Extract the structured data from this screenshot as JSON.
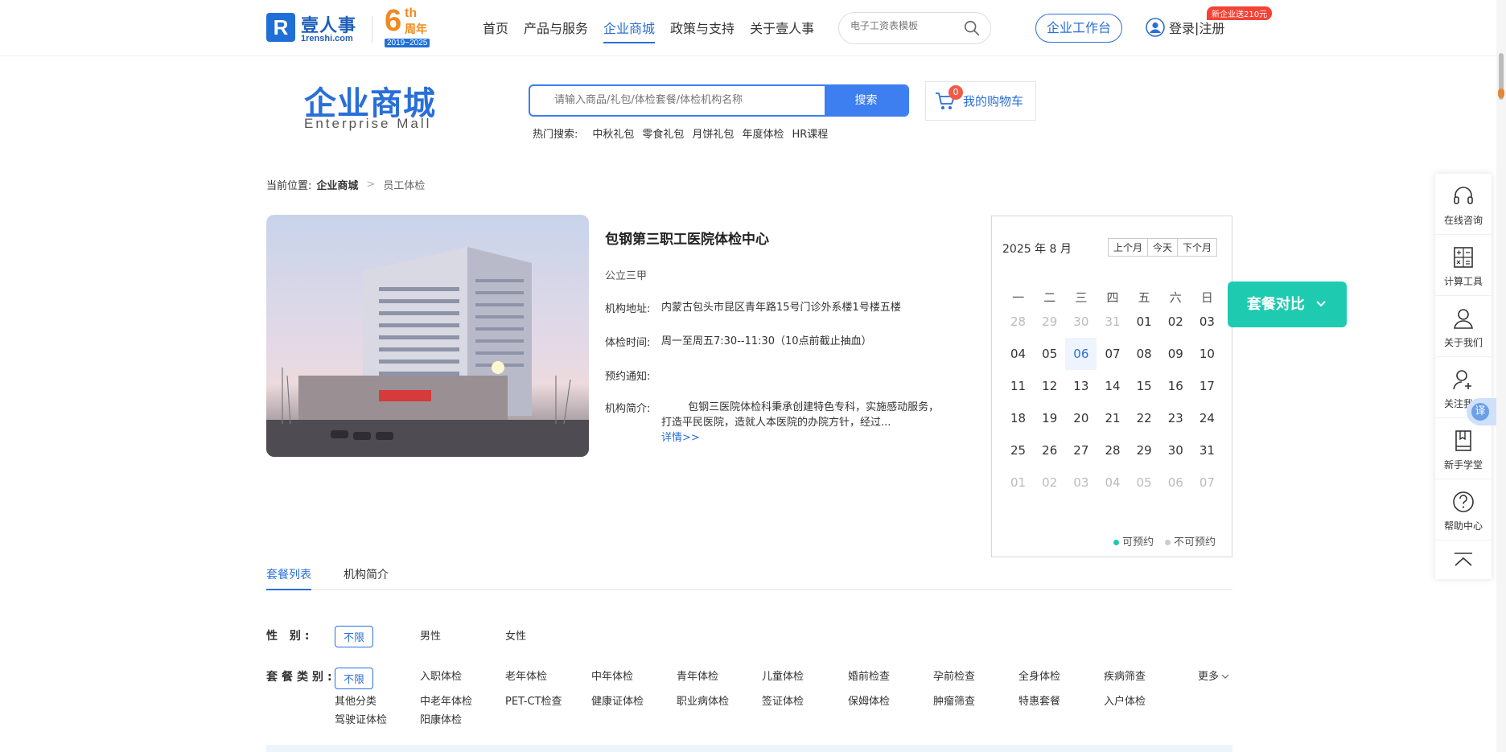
{
  "logo": {
    "brand": "壹人事",
    "domain": "1renshi.com",
    "mark": "R"
  },
  "anniversary": {
    "num": "6",
    "suffix": "th",
    "zh": "周年",
    "years": "2019~2025"
  },
  "nav": {
    "items": [
      {
        "label": "首页"
      },
      {
        "label": "产品与服务"
      },
      {
        "label": "企业商城"
      },
      {
        "label": "政策与支持"
      },
      {
        "label": "关于壹人事"
      }
    ]
  },
  "top_search": {
    "placeholder": "电子工资表模板"
  },
  "workbench_label": "企业工作台",
  "login": {
    "login": "登录",
    "sep": " | ",
    "register": "注册",
    "promo": "新企业送210元"
  },
  "mall": {
    "title": "企业商城",
    "subtitle": "Enterprise  Mall"
  },
  "mall_search": {
    "placeholder": "请输入商品/礼包/体检套餐/体检机构名称",
    "button": "搜索"
  },
  "hot": {
    "label": "热门搜索:",
    "items": [
      "中秋礼包",
      "零食礼包",
      "月饼礼包",
      "年度体检",
      "HR课程"
    ]
  },
  "cart": {
    "label": "我的购物车",
    "count": "0"
  },
  "breadcrumb": {
    "prefix": "当前位置:",
    "section": "企业商城",
    "leaf": "员工体检"
  },
  "hospital": {
    "name": "包钢第三职工医院体检中心",
    "grade": "公立三甲",
    "address_label": "机构地址:",
    "address": "内蒙古包头市昆区青年路15号门诊外系楼1号楼五楼",
    "hours_label": "体检时间:",
    "hours": "周一至周五7:30--11:30（10点前截止抽血）",
    "notice_label": "预约通知:",
    "notice": "",
    "intro_label": "机构简介:",
    "intro": "        包钢三医院体检科秉承创建特色专科，实施感动服务，打造平民医院，造就人本医院的办院方针，经过...",
    "more": "详情>>"
  },
  "calendar": {
    "title": "2025 年 8 月",
    "buttons": [
      "上个月",
      "今天",
      "下个月"
    ],
    "weekdays": [
      "一",
      "二",
      "三",
      "四",
      "五",
      "六",
      "日"
    ],
    "days": [
      {
        "d": "28",
        "o": true
      },
      {
        "d": "29",
        "o": true
      },
      {
        "d": "30",
        "o": true
      },
      {
        "d": "31",
        "o": true
      },
      {
        "d": "01"
      },
      {
        "d": "02"
      },
      {
        "d": "03"
      },
      {
        "d": "04"
      },
      {
        "d": "05"
      },
      {
        "d": "06",
        "t": true
      },
      {
        "d": "07"
      },
      {
        "d": "08"
      },
      {
        "d": "09"
      },
      {
        "d": "10"
      },
      {
        "d": "11"
      },
      {
        "d": "12"
      },
      {
        "d": "13"
      },
      {
        "d": "14"
      },
      {
        "d": "15"
      },
      {
        "d": "16"
      },
      {
        "d": "17"
      },
      {
        "d": "18"
      },
      {
        "d": "19"
      },
      {
        "d": "20"
      },
      {
        "d": "21"
      },
      {
        "d": "22"
      },
      {
        "d": "23"
      },
      {
        "d": "24"
      },
      {
        "d": "25"
      },
      {
        "d": "26"
      },
      {
        "d": "27"
      },
      {
        "d": "28"
      },
      {
        "d": "29"
      },
      {
        "d": "30"
      },
      {
        "d": "31"
      },
      {
        "d": "01",
        "o": true
      },
      {
        "d": "02",
        "o": true
      },
      {
        "d": "03",
        "o": true
      },
      {
        "d": "04",
        "o": true
      },
      {
        "d": "05",
        "o": true
      },
      {
        "d": "06",
        "o": true
      },
      {
        "d": "07",
        "o": true
      }
    ],
    "legend_available": "可预约",
    "legend_unavailable": "不可预约",
    "available_color": "#1ecbb0",
    "unavailable_color": "#cccccc"
  },
  "compare_label": "套餐对比",
  "tabs": [
    "套餐列表",
    "机构简介"
  ],
  "filters": {
    "gender_label": "性 别:",
    "gender_all": "不限",
    "gender_options": [
      "男性",
      "女性"
    ],
    "category_label": "套餐类别:",
    "category_all": "不限",
    "category_row1": [
      "入职体检",
      "老年体检",
      "中年体检",
      "青年体检",
      "儿童体检",
      "婚前检查",
      "孕前检查",
      "全身体检",
      "疾病筛查"
    ],
    "category_row2": [
      "其他分类",
      "中老年体检",
      "PET-CT检查",
      "健康证体检",
      "职业病体检",
      "签证体检",
      "保姆体检",
      "肿瘤筛查",
      "特惠套餐",
      "入户体检"
    ],
    "category_row3": [
      "驾驶证体检",
      "阳康体检"
    ],
    "more": "更多"
  },
  "side_tools": [
    "在线咨询",
    "计算工具",
    "关于我们",
    "关注我们",
    "新手学堂",
    "帮助中心"
  ],
  "translate": "译",
  "accent_color": "#2a6fd8"
}
